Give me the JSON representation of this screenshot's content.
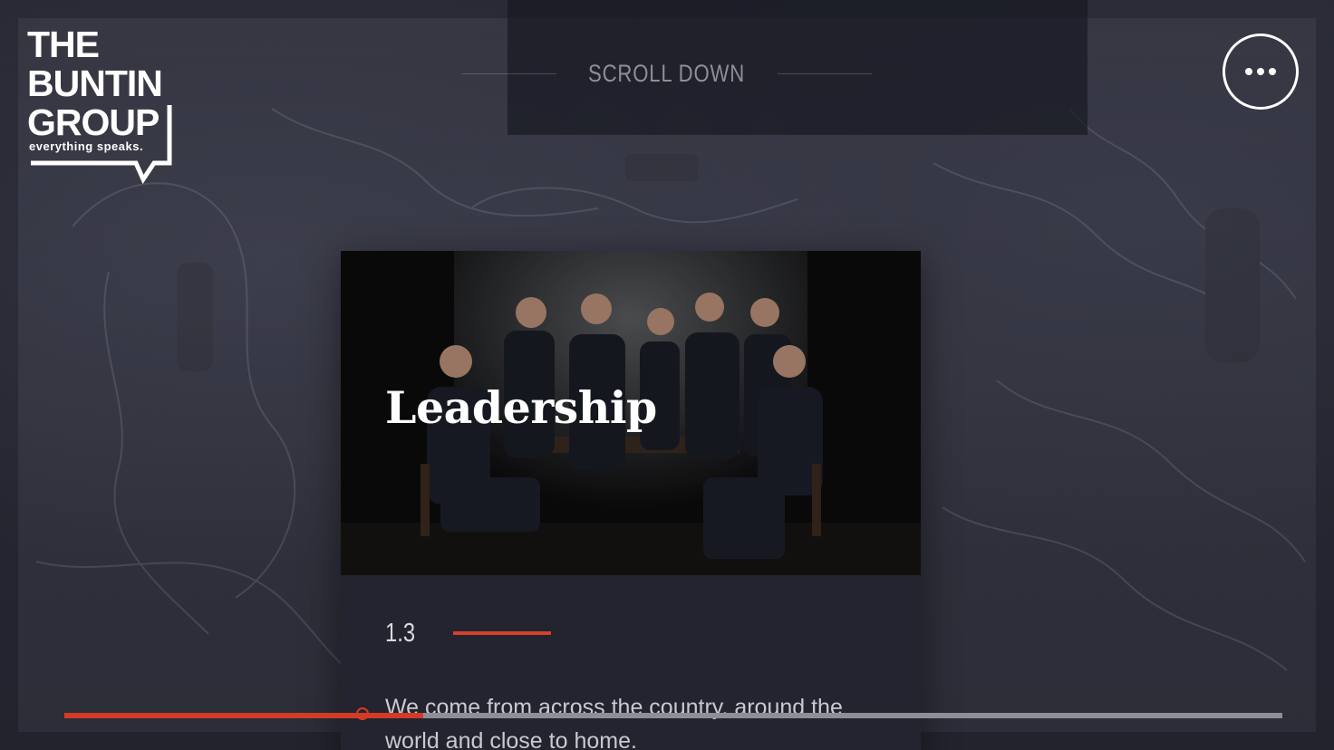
{
  "brand": {
    "line1": "THE",
    "line2": "BUNTIN",
    "line3": "GROUP",
    "tagline": "everything speaks."
  },
  "header": {
    "scroll_hint": "SCROLL DOWN",
    "menu_icon": "more-dots-icon"
  },
  "card": {
    "title": "Leadership",
    "number": "1.3",
    "text": "We come from across the country, around the world and close to home."
  },
  "progress": {
    "fraction": 0.295,
    "marker_fraction": 0.245
  },
  "colors": {
    "accent": "#d43b26",
    "background": "#2c2d39",
    "card_body": "#23242f",
    "text": "#ffffff"
  }
}
